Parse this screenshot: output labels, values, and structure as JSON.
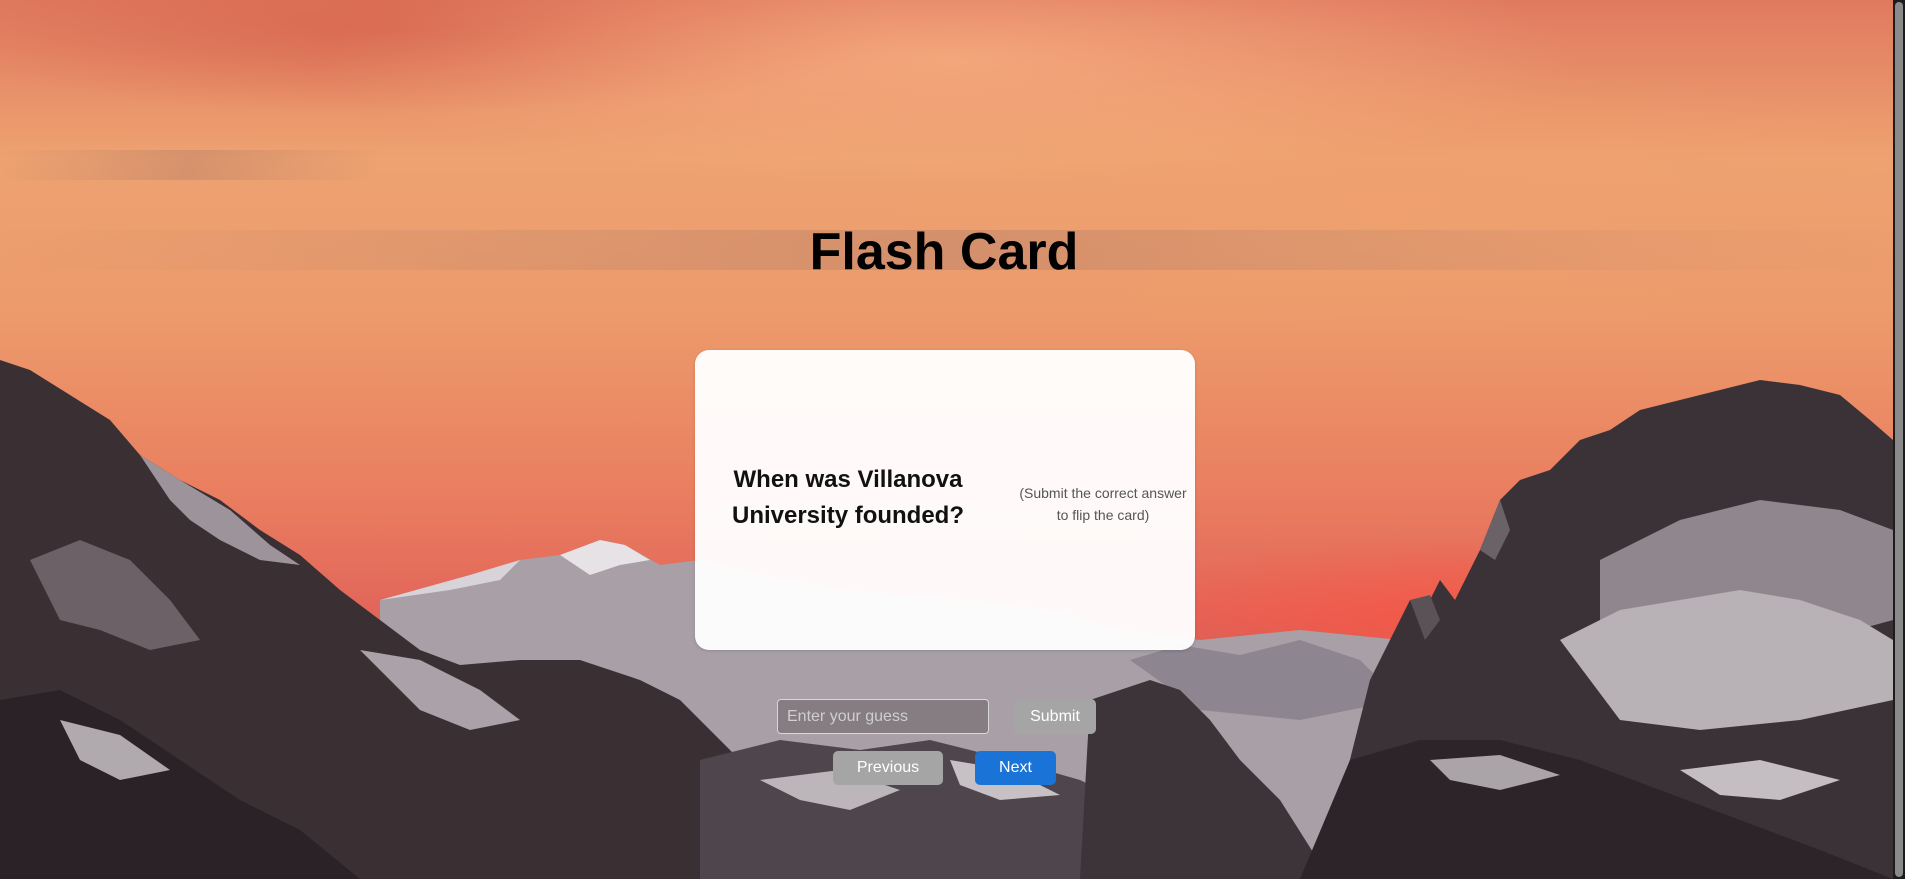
{
  "page": {
    "title": "Flash Card"
  },
  "card": {
    "question": "When was Villanova University founded?",
    "hint": "(Submit the correct answer to flip the card)"
  },
  "guess": {
    "placeholder": "Enter your guess",
    "value": ""
  },
  "buttons": {
    "submit_label": "Submit",
    "previous_label": "Previous",
    "next_label": "Next"
  },
  "colors": {
    "next_button": "#1a73d6",
    "secondary_button": "#a5a5a5",
    "title_text": "#000000"
  }
}
